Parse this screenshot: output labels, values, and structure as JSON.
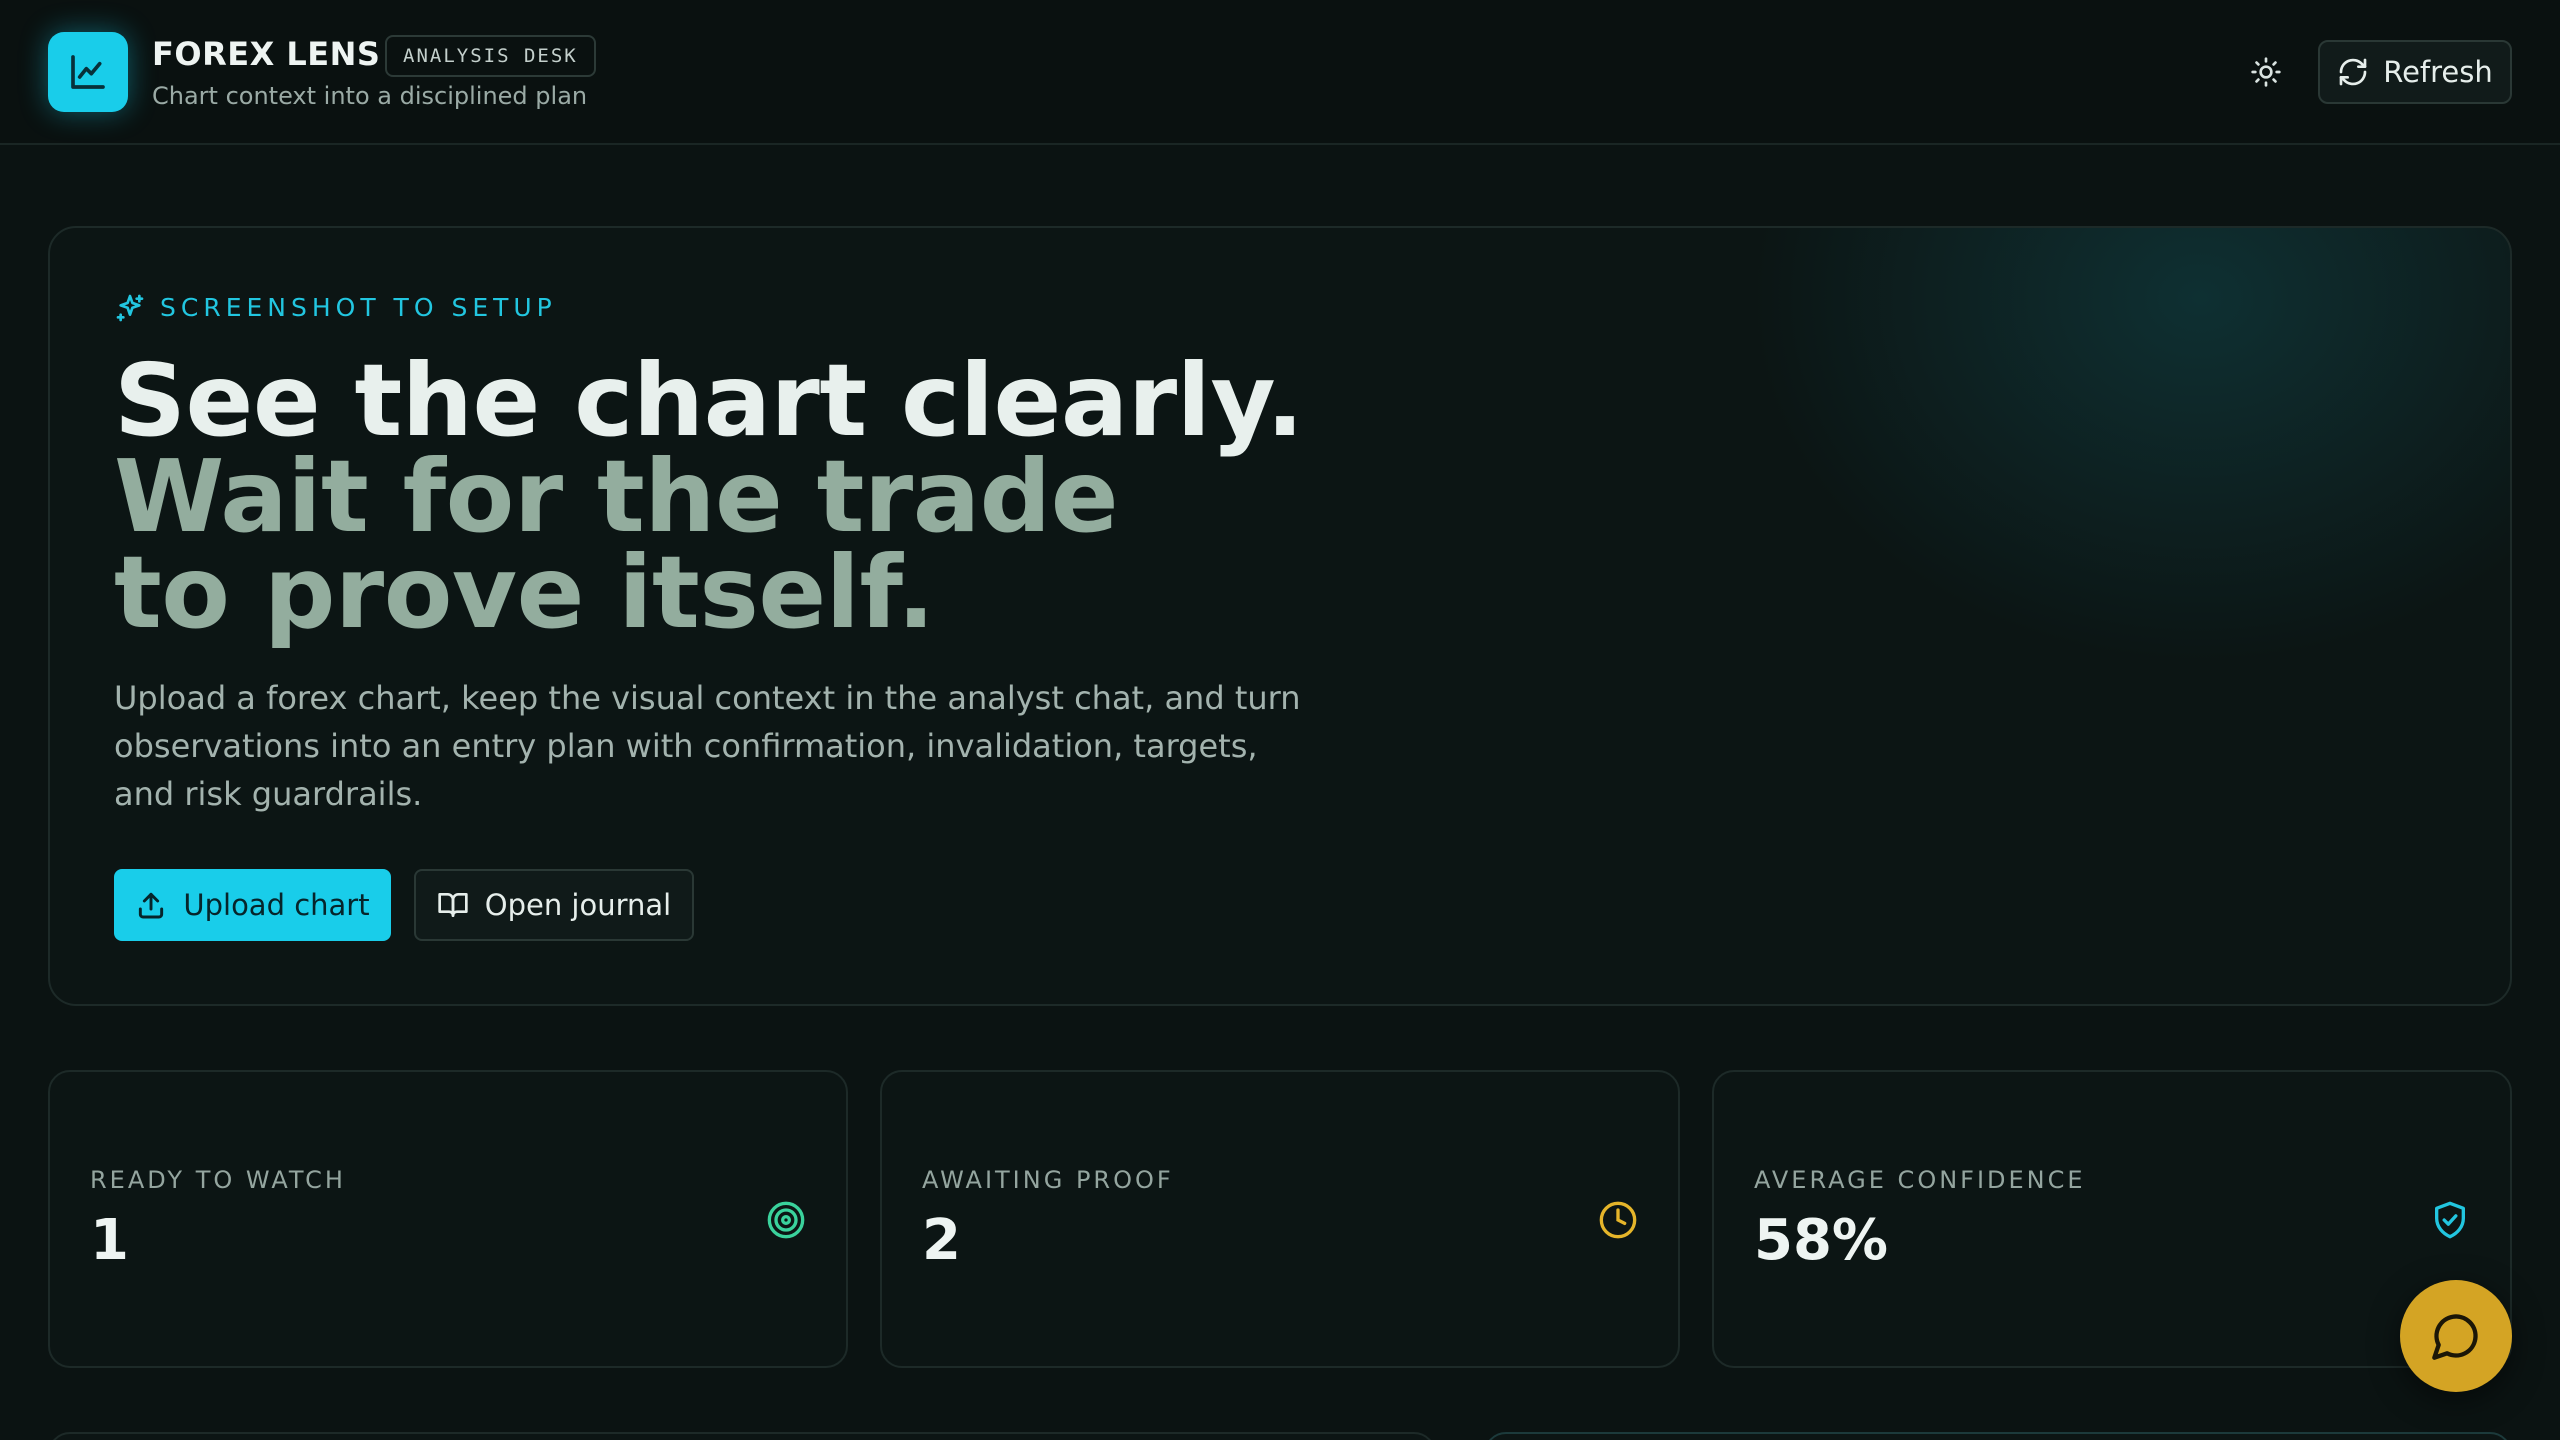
{
  "header": {
    "brand_name": "FOREX LENS",
    "desk_badge": "ANALYSIS DESK",
    "tagline": "Chart context into a disciplined plan",
    "refresh_label": "Refresh",
    "icons": {
      "logo": "line-chart-icon",
      "theme": "sun-icon",
      "refresh": "refresh-icon"
    }
  },
  "hero": {
    "eyebrow": "SCREENSHOT TO SETUP",
    "headline_line1": "See the chart clearly.",
    "headline_line2": "Wait for the trade",
    "headline_line3": "to prove itself.",
    "description": "Upload a forex chart, keep the visual context in the analyst chat, and turn observations into an entry plan with confirmation, invalidation, targets, and risk guardrails.",
    "upload_label": "Upload chart",
    "journal_label": "Open journal",
    "icons": {
      "eyebrow": "sparkles-icon",
      "upload": "upload-icon",
      "journal": "book-open-icon"
    }
  },
  "stats": [
    {
      "label": "READY TO WATCH",
      "value": "1",
      "icon": "target-icon",
      "color": "#3ad29c"
    },
    {
      "label": "AWAITING PROOF",
      "value": "2",
      "icon": "clock-icon",
      "color": "#e5b52a"
    },
    {
      "label": "AVERAGE CONFIDENCE",
      "value": "58%",
      "icon": "shield-check-icon",
      "color": "#22c6e0"
    }
  ],
  "chat": {
    "icon": "chat-bubble-icon"
  },
  "colors": {
    "accent": "#19cdea",
    "background": "#0b1312",
    "chat_fab": "#d4a424",
    "headline_muted": "#93ad9e"
  }
}
